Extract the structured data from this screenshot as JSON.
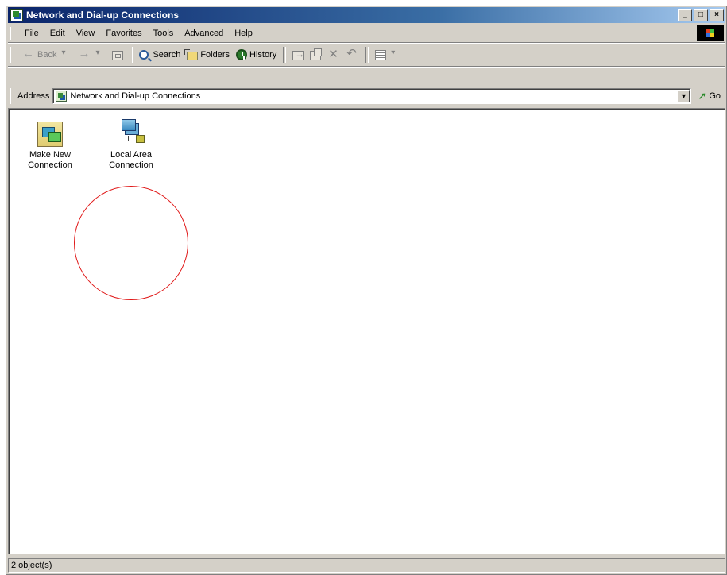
{
  "window": {
    "title": "Network and Dial-up Connections",
    "controls": {
      "minimize": "_",
      "maximize": "□",
      "close": "×"
    }
  },
  "menubar": {
    "items": [
      "File",
      "Edit",
      "View",
      "Favorites",
      "Tools",
      "Advanced",
      "Help"
    ]
  },
  "toolbar": {
    "back_label": "Back",
    "search_label": "Search",
    "folders_label": "Folders",
    "history_label": "History"
  },
  "address": {
    "label": "Address",
    "value": "Network and Dial-up Connections",
    "go_label": "Go"
  },
  "content": {
    "items": [
      {
        "line1": "Make New",
        "line2": "Connection",
        "icon": "make-new-connection-icon"
      },
      {
        "line1": "Local Area",
        "line2": "Connection",
        "icon": "local-area-connection-icon"
      }
    ],
    "annotation": {
      "shape": "circle",
      "color": "#e01818",
      "target": "Local Area Connection"
    }
  },
  "statusbar": {
    "text": "2 object(s)"
  },
  "colors": {
    "titlebar_start": "#0a246a",
    "titlebar_end": "#a6caf0",
    "chrome": "#d4d0c8",
    "annotation": "#e01818"
  }
}
